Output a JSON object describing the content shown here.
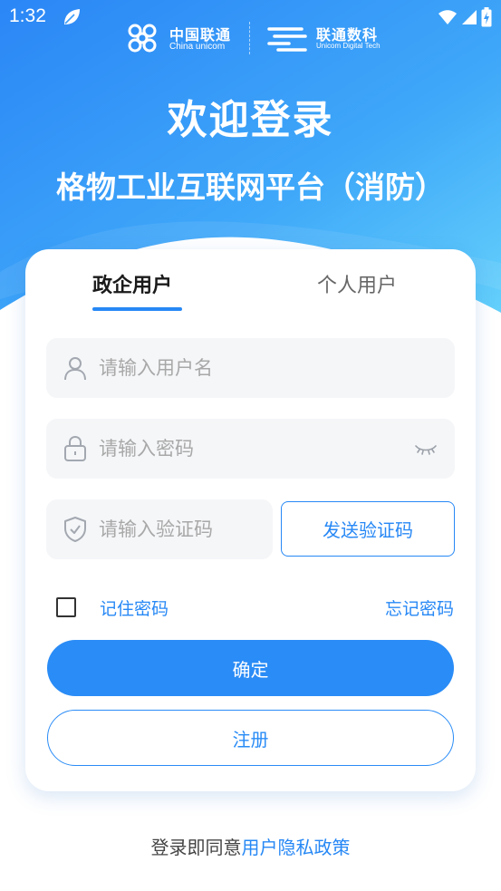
{
  "status_bar": {
    "time": "1:32",
    "icons": [
      "leaf-icon",
      "wifi-icon",
      "signal-icon",
      "battery-charging-icon"
    ]
  },
  "brand": {
    "china_unicom_cn": "中国联通",
    "china_unicom_en": "China unicom",
    "digital_tech_cn": "联通数科",
    "digital_tech_en": "Unicom Digital Tech"
  },
  "hero": {
    "welcome": "欢迎登录",
    "platform": "格物工业互联网平台（消防）"
  },
  "tabs": [
    {
      "label": "政企用户",
      "active": true
    },
    {
      "label": "个人用户",
      "active": false
    }
  ],
  "form": {
    "username_placeholder": "请输入用户名",
    "password_placeholder": "请输入密码",
    "code_placeholder": "请输入验证码",
    "send_code_label": "发送验证码",
    "remember_label": "记住密码",
    "remember_checked": false,
    "forgot_label": "忘记密码",
    "confirm_label": "确定",
    "register_label": "注册"
  },
  "agreement": {
    "prefix": "登录即同意",
    "link": "用户隐私政策"
  },
  "colors": {
    "accent": "#2788f5",
    "hero_top": "#2e8ff7",
    "hero_bottom": "#5cc8fb",
    "field_bg": "#f5f6f8"
  }
}
